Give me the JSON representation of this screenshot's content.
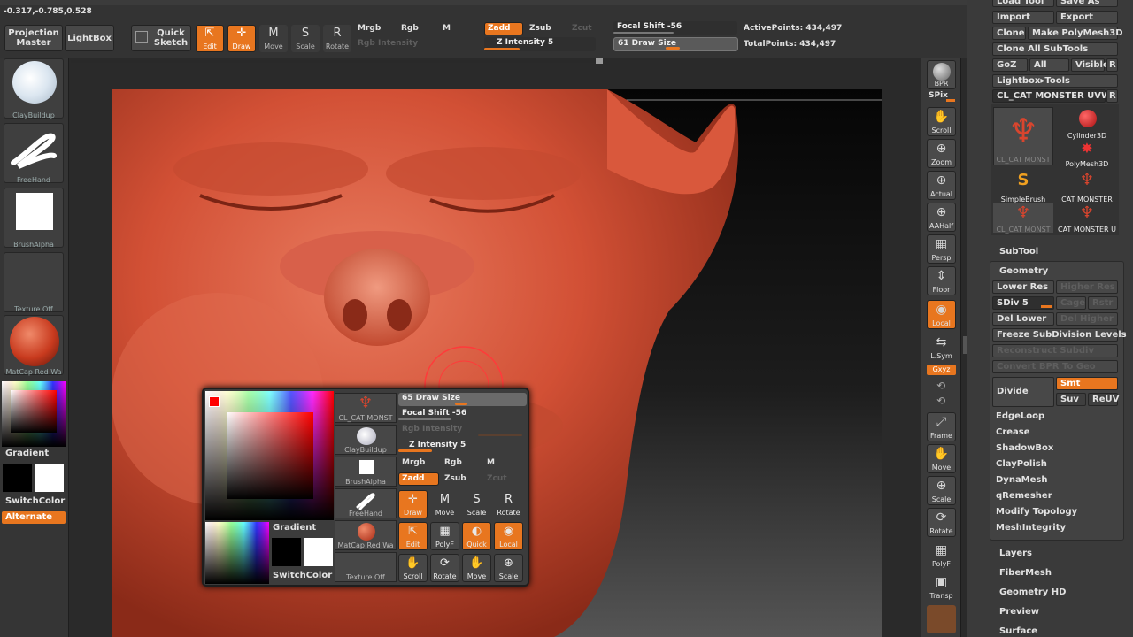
{
  "coords": "-0.317,-0.785,0.528",
  "topbar": {
    "projection_master": "Projection Master",
    "lightbox": "LightBox",
    "quick_sketch": "Quick Sketch",
    "modes": [
      "Edit",
      "Draw",
      "Move",
      "Scale",
      "Rotate"
    ],
    "mrgb": "Mrgb",
    "rgb": "Rgb",
    "m": "M",
    "rgb_intensity": "Rgb Intensity",
    "zadd": "Zadd",
    "zsub": "Zsub",
    "zcut": "Zcut",
    "z_intensity": "Z Intensity 5",
    "focal_shift": "Focal Shift -56",
    "draw_size": "61 Draw Size",
    "active_points": "ActivePoints: 434,497",
    "total_points": "TotalPoints: 434,497"
  },
  "leftshelf": {
    "brush": "ClayBuildup",
    "stroke": "FreeHand",
    "alpha": "BrushAlpha",
    "texture": "Texture Off",
    "material": "MatCap Red Wa",
    "gradient": "Gradient",
    "switchcolor": "SwitchColor",
    "alternate": "Alternate"
  },
  "rightshelf": [
    {
      "icon": "sphere-icon",
      "label": "BPR"
    },
    {
      "icon": "none",
      "label": "SPix"
    },
    {
      "icon": "hand-icon",
      "label": "Scroll"
    },
    {
      "icon": "zoom-icon",
      "label": "Zoom"
    },
    {
      "icon": "zoom-icon",
      "label": "Actual"
    },
    {
      "icon": "zoom-icon",
      "label": "AAHalf"
    },
    {
      "icon": "grid-icon",
      "label": "Persp"
    },
    {
      "icon": "floor-icon",
      "label": "Floor"
    },
    {
      "icon": "local-icon",
      "label": "Local"
    },
    {
      "icon": "sym-icon",
      "label": "L.Sym"
    },
    {
      "icon": "xyz-icon",
      "label": "Gxyz"
    },
    {
      "icon": "frame-icon",
      "label": "Frame"
    },
    {
      "icon": "hand-icon",
      "label": "Move"
    },
    {
      "icon": "zoom-icon",
      "label": "Scale"
    },
    {
      "icon": "rotate-icon",
      "label": "Rotate"
    },
    {
      "icon": "grid-icon",
      "label": "PolyF"
    },
    {
      "icon": "transp-icon",
      "label": "Transp"
    }
  ],
  "toolpanel": {
    "load_tool": "Load Tool",
    "save_as": "Save As",
    "import": "Import",
    "export": "Export",
    "clone": "Clone",
    "make_polymesh": "Make PolyMesh3D",
    "clone_all": "Clone All SubTools",
    "goz": "GoZ",
    "all": "All",
    "visible": "Visible",
    "r": "R",
    "lightbox_tools": "Lightbox▸Tools",
    "current_tool": "CL_CAT MONSTER UVW.",
    "tools": [
      "CL_CAT MONST",
      "Cylinder3D",
      "PolyMesh3D",
      "SimpleBrush",
      "CAT MONSTER",
      "CL_CAT MONST",
      "CAT MONSTER U"
    ],
    "subtool": "SubTool",
    "geometry": "Geometry",
    "lower_res": "Lower Res",
    "higher_res": "Higher Res",
    "sdiv": "SDiv 5",
    "cage": "Cage",
    "rstr": "Rstr",
    "del_lower": "Del Lower",
    "del_higher": "Del Higher",
    "freeze": "Freeze SubDivision Levels",
    "reconstruct": "Reconstruct Subdiv",
    "convert_bpr": "Convert BPR To Geo",
    "divide": "Divide",
    "smt": "Smt",
    "suv": "Suv",
    "reuv": "ReUV",
    "geo_items": [
      "EdgeLoop",
      "Crease",
      "ShadowBox",
      "ClayPolish",
      "DynaMesh",
      "qRemesher",
      "Modify Topology",
      "MeshIntegrity"
    ],
    "sections": [
      "Layers",
      "FiberMesh",
      "Geometry HD",
      "Preview",
      "Surface"
    ]
  },
  "popup": {
    "draw_size": "65 Draw Size",
    "focal_shift": "Focal Shift -56",
    "rgb_intensity": "Rgb Intensity",
    "z_intensity": "Z Intensity 5",
    "mrgb": "Mrgb",
    "rgb": "Rgb",
    "m": "M",
    "zadd": "Zadd",
    "zsub": "Zsub",
    "zcut": "Zcut",
    "thumbs": [
      "CL_CAT MONST",
      "ClayBuildup",
      "BrushAlpha",
      "FreeHand",
      "MatCap Red Wa",
      "Texture Off"
    ],
    "gradient": "Gradient",
    "switchcolor": "SwitchColor",
    "row1": [
      "Draw",
      "Move",
      "Scale",
      "Rotate"
    ],
    "row2": [
      "Edit",
      "PolyF",
      "Quick",
      "Local"
    ],
    "row3": [
      "Scroll",
      "Rotate",
      "Move",
      "Scale"
    ]
  },
  "colors": {
    "accent": "#e8761f",
    "background": "#3a3a3a",
    "model": "#d25035"
  }
}
